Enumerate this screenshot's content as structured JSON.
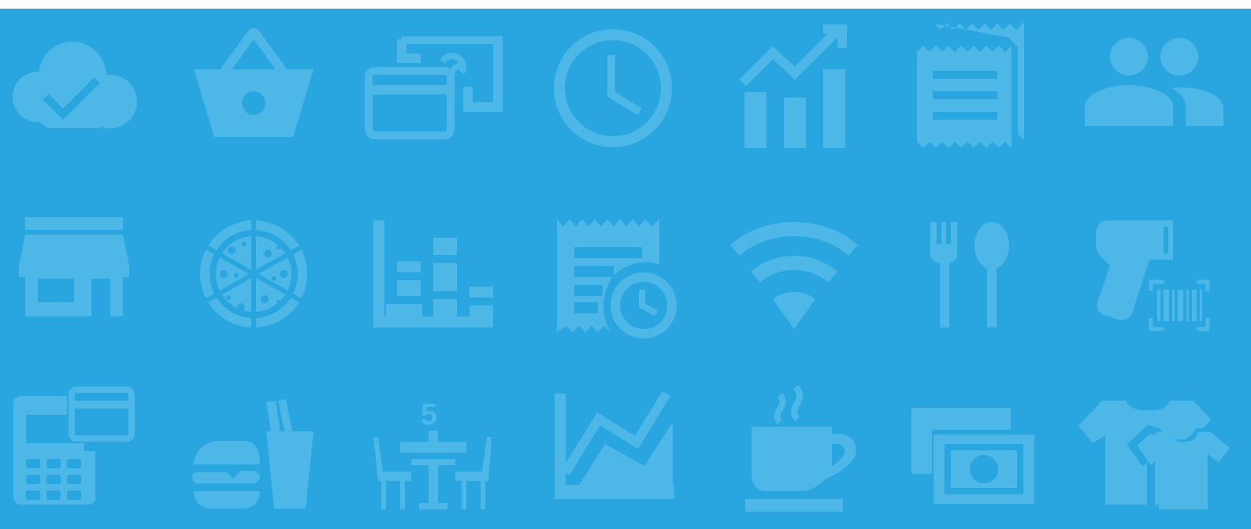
{
  "colors": {
    "background": "#29a6df",
    "icon": "#4db8e8",
    "top_strip": "#ffffff"
  },
  "icons": [
    "cloud-check-icon",
    "shopping-basket-icon",
    "card-and-cash-icon",
    "clock-icon",
    "growth-chart-icon",
    "receipt-icon",
    "people-icon",
    "storefront-icon",
    "pizza-icon",
    "bar-steps-chart-icon",
    "receipt-clock-icon",
    "wifi-icon",
    "fork-spoon-icon",
    "barcode-scanner-icon",
    "card-terminal-icon",
    "burger-drink-icon",
    "table-number-icon",
    "area-line-chart-icon",
    "hot-coffee-icon",
    "cash-bills-icon",
    "tshirts-icon"
  ],
  "table_number": "5"
}
